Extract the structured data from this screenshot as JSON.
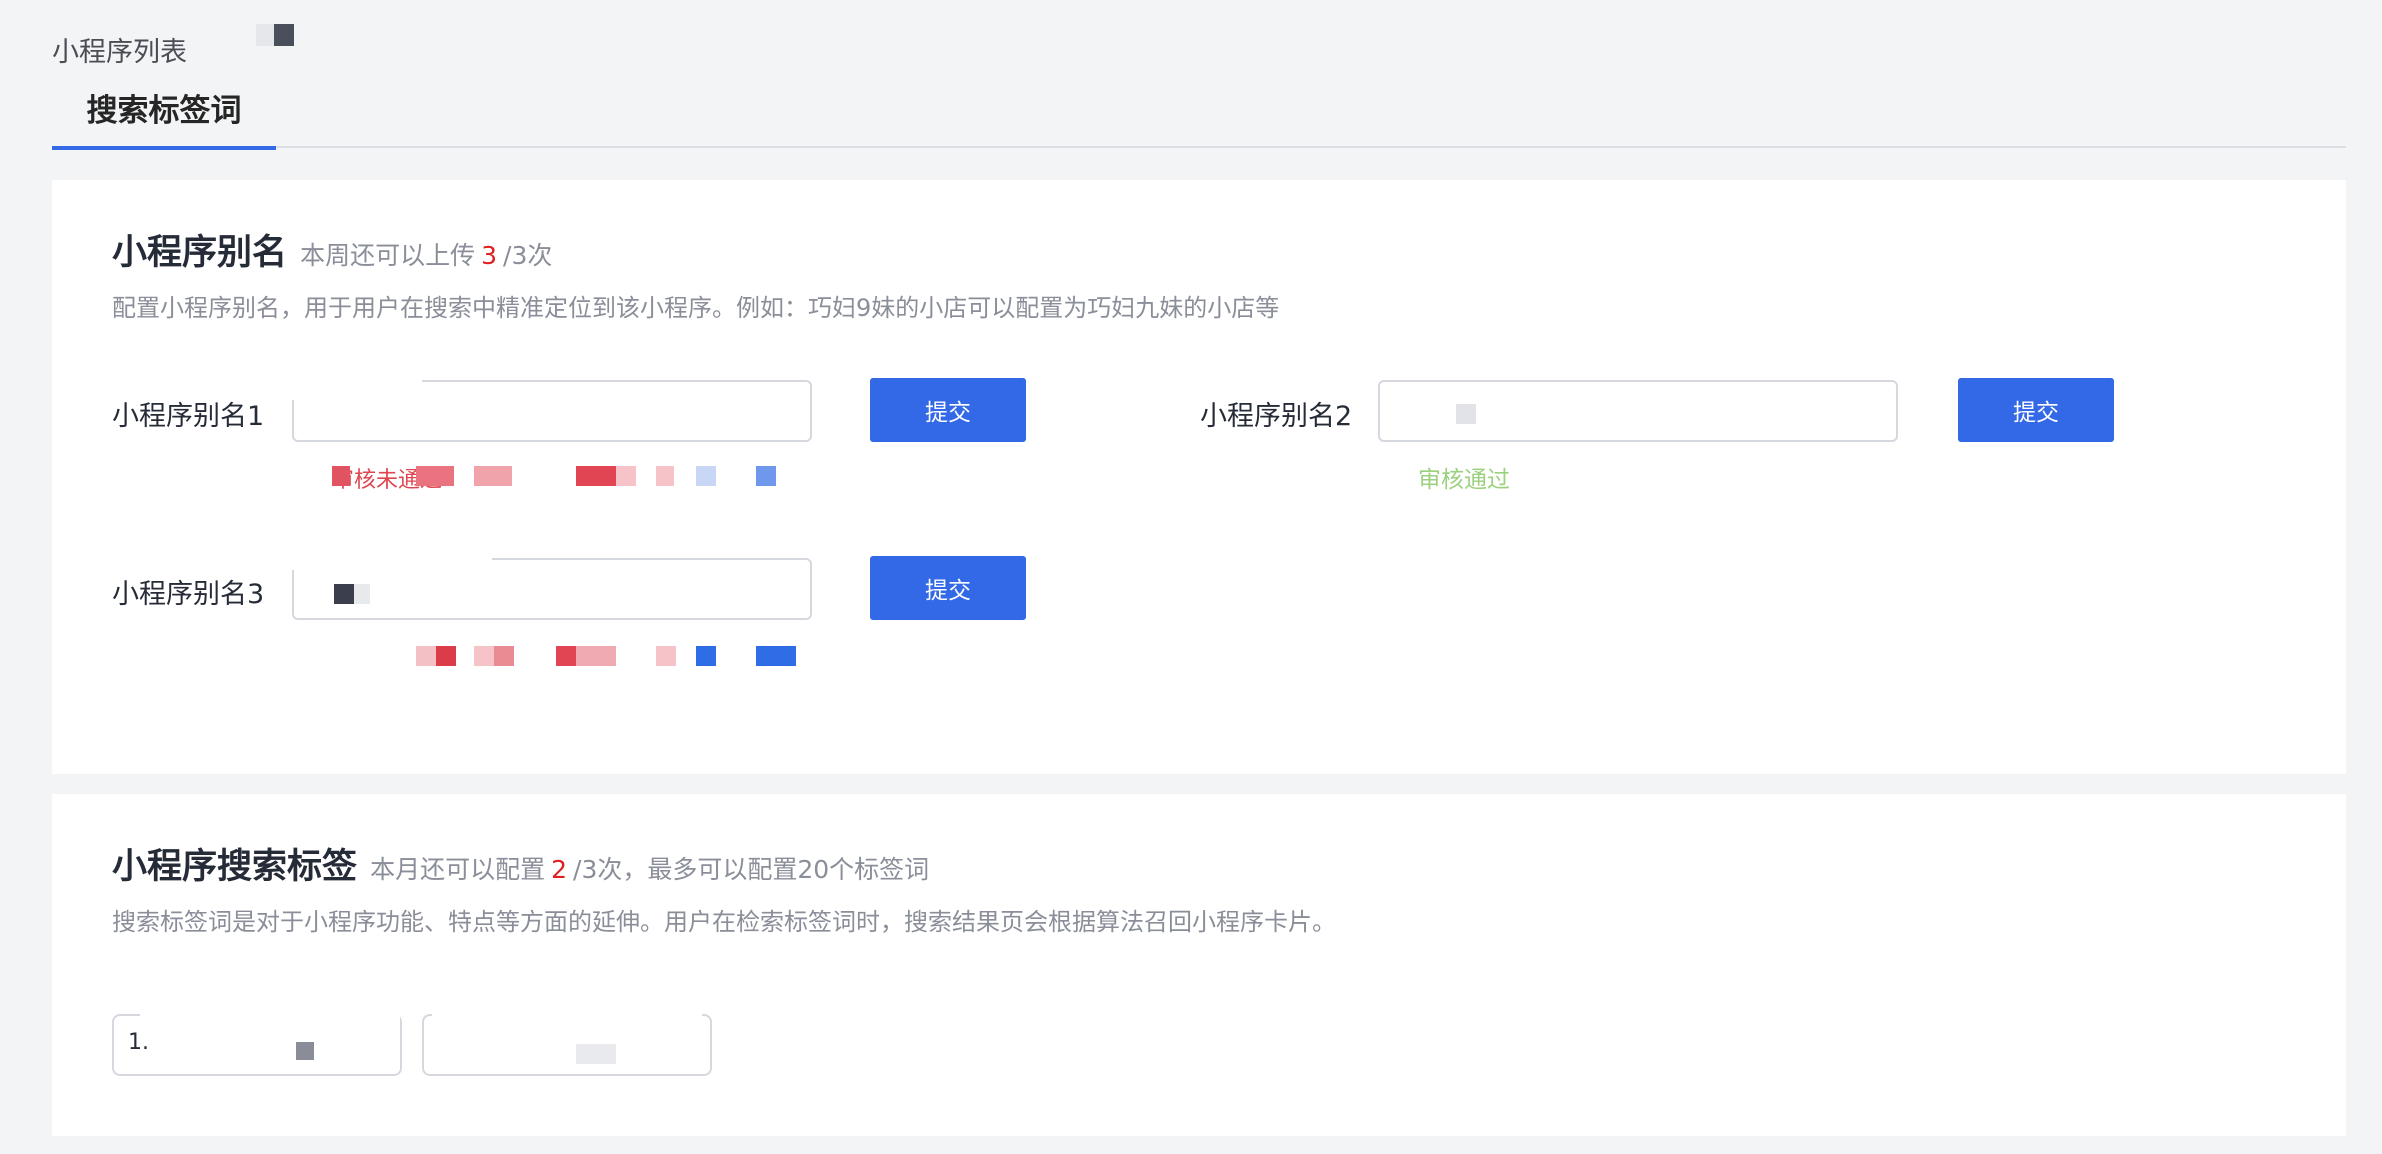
{
  "breadcrumb": {
    "text": "小程序列表"
  },
  "tabs": [
    {
      "label": "搜索标签词",
      "active": true
    }
  ],
  "alias_section": {
    "title": "小程序别名",
    "quota_prefix": "本周还可以上传",
    "quota_count": "3",
    "quota_suffix": "/3次",
    "description": "配置小程序别名，用于用户在搜索中精准定位到该小程序。例如：巧妇9妹的小店可以配置为巧妇九妹的小店等",
    "submit_label": "提交",
    "fields": [
      {
        "label": "小程序别名1",
        "value": "",
        "status": "审核未通过",
        "status_type": "fail"
      },
      {
        "label": "小程序别名2",
        "value": "",
        "status": "审核通过",
        "status_type": "ok"
      },
      {
        "label": "小程序别名3",
        "value": "",
        "status": "",
        "status_type": "fail"
      }
    ]
  },
  "tag_section": {
    "title": "小程序搜索标签",
    "quota_prefix": "本月还可以配置",
    "quota_count": "2",
    "quota_suffix": "/3次，最多可以配置20个标签词",
    "description": "搜索标签词是对于小程序功能、特点等方面的延伸。用户在检索标签词时，搜索结果页会根据算法召回小程序卡片。",
    "tags": [
      {
        "index": "1."
      },
      {
        "index": ""
      }
    ]
  },
  "colors": {
    "primary": "#3369e7",
    "danger": "#e02020",
    "success": "#9bd17e",
    "muted": "#8a8e99"
  }
}
